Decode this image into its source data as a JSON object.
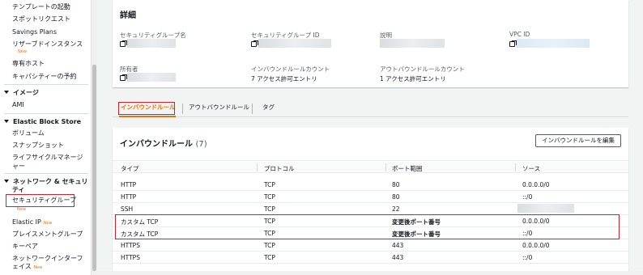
{
  "sidebar": {
    "items_top": [
      {
        "label": "テンプレートの起動",
        "new": ""
      },
      {
        "label": "スポットリクエスト",
        "new": ""
      },
      {
        "label": "Savings Plans",
        "new": ""
      },
      {
        "label": "リザーブドインスタンス",
        "new": "New"
      },
      {
        "label": "専有ホスト",
        "new": ""
      },
      {
        "label": "キャパシティーの予約",
        "new": ""
      }
    ],
    "section_images": "イメージ",
    "images_items": [
      {
        "label": "AMI",
        "new": ""
      }
    ],
    "section_ebs": "Elastic Block Store",
    "ebs_items": [
      {
        "label": "ボリューム"
      },
      {
        "label": "スナップショット"
      },
      {
        "label": "ライフサイクルマネージ",
        "label2": "ャー"
      }
    ],
    "section_network_l1": "ネットワーク & セキュリ",
    "section_network_l2": "ティ",
    "network_items": [
      {
        "label": "セキュリティグループ",
        "new": "New"
      },
      {
        "label": "Elastic IP",
        "new": "New"
      },
      {
        "label": "プレイスメントグループ",
        "new": ""
      },
      {
        "label": "キーペア",
        "new": ""
      },
      {
        "label": "ネットワークインターフ",
        "label2": "ェイス",
        "new": "New"
      }
    ]
  },
  "details": {
    "title": "詳細",
    "sg_name_label": "セキュリティグループ名",
    "sg_id_label": "セキュリティグループ ID",
    "description_label": "説明",
    "vpc_id_label": "VPC ID",
    "owner_label": "所有者",
    "inbound_count_label": "インバウンドルールカウント",
    "inbound_count_value": "7 アクセス許可エントリ",
    "outbound_count_label": "アウトバウンドルールカウント",
    "outbound_count_value": "1 アクセス許可エントリ"
  },
  "tabs": {
    "inbound": "インバウンドルール",
    "outbound": "アウトバウンドルール",
    "tags": "タグ"
  },
  "rules": {
    "title": "インバウンドルール",
    "count": "(7)",
    "edit_button": "インバウンドルールを編集",
    "headers": {
      "type": "タイプ",
      "protocol": "プロトコル",
      "port": "ポート範囲",
      "source": "ソース"
    },
    "rows": [
      {
        "type": "HTTP",
        "protocol": "TCP",
        "port": "80",
        "source": "0.0.0.0/0"
      },
      {
        "type": "HTTP",
        "protocol": "TCP",
        "port": "80",
        "source": "::/0"
      },
      {
        "type": "SSH",
        "protocol": "TCP",
        "port": "22",
        "source": ""
      },
      {
        "type": "カスタム TCP",
        "protocol": "TCP",
        "port": "変更後ポート番号",
        "source": "0.0.0.0/0"
      },
      {
        "type": "カスタム TCP",
        "protocol": "TCP",
        "port": "変更後ポート番号",
        "source": "::/0"
      },
      {
        "type": "HTTPS",
        "protocol": "TCP",
        "port": "443",
        "source": "0.0.0.0/0"
      },
      {
        "type": "HTTPS",
        "protocol": "TCP",
        "port": "443",
        "source": "::/0"
      }
    ]
  },
  "colors": {
    "highlight_red": "#d0212c",
    "accent_orange": "#ec7211",
    "new_badge": "#ec7211"
  }
}
